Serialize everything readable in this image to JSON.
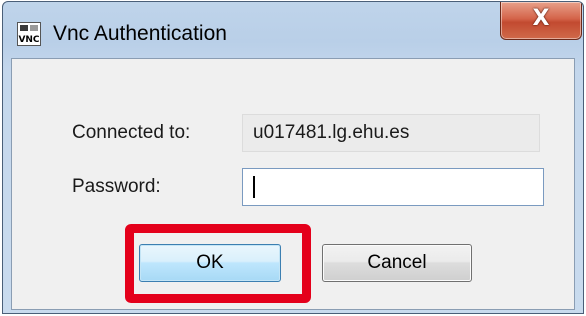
{
  "window": {
    "title": "Vnc Authentication",
    "close_glyph": "X",
    "icon": "vnc-app-icon"
  },
  "form": {
    "connected_label": "Connected to:",
    "connected_value": "u017481.lg.ehu.es",
    "password_label": "Password:",
    "password_value": ""
  },
  "buttons": {
    "ok_label": "OK",
    "cancel_label": "Cancel"
  },
  "colors": {
    "highlight": "#e4001b",
    "ok_border": "#3c7fb1",
    "close_button": "#c24a30"
  }
}
